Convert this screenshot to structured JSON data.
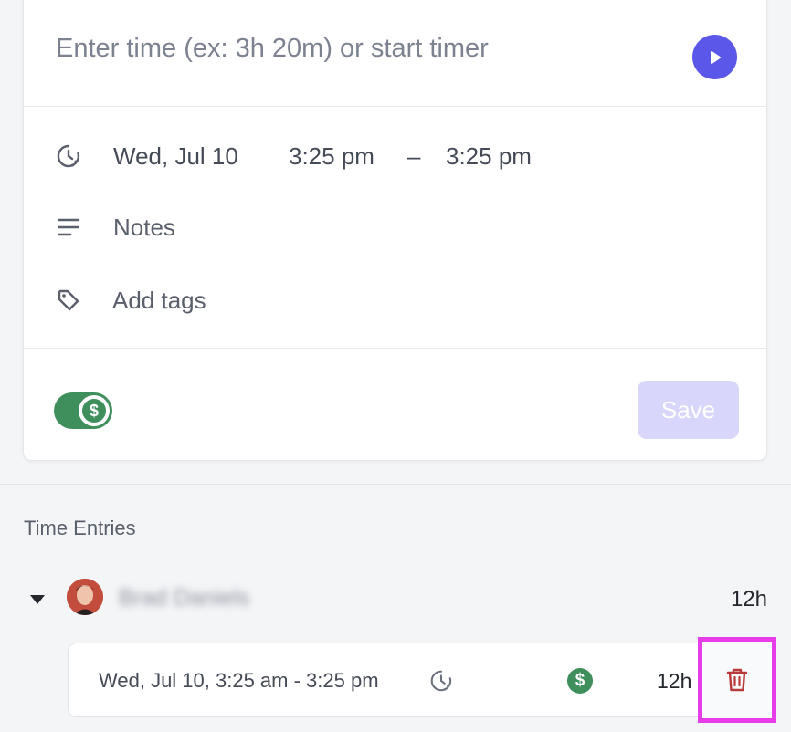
{
  "timer": {
    "input_placeholder": "Enter time (ex: 3h 20m) or start timer",
    "input_value": "",
    "play_icon": "play-icon"
  },
  "details": {
    "date": "Wed, Jul 10",
    "start_time": "3:25 pm",
    "dash": "–",
    "end_time": "3:25 pm",
    "notes_label": "Notes",
    "tags_label": "Add tags",
    "icons": [
      "clock-icon",
      "notes-icon",
      "tag-icon"
    ]
  },
  "footer": {
    "billable_symbol": "$",
    "billable_enabled": true,
    "save_label": "Save"
  },
  "entries": {
    "section_title": "Time Entries",
    "group": {
      "user_name": "Brad Daniels",
      "total": "12h"
    },
    "items": [
      {
        "range": "Wed, Jul 10, 3:25 am - 3:25 pm",
        "billable_symbol": "$",
        "duration": "12h"
      }
    ]
  },
  "colors": {
    "accent": "#5b57e8",
    "billable": "#3f8f5d",
    "save_disabled": "#d8d6fb",
    "delete": "#b83a3a",
    "highlight": "#e63de8"
  }
}
